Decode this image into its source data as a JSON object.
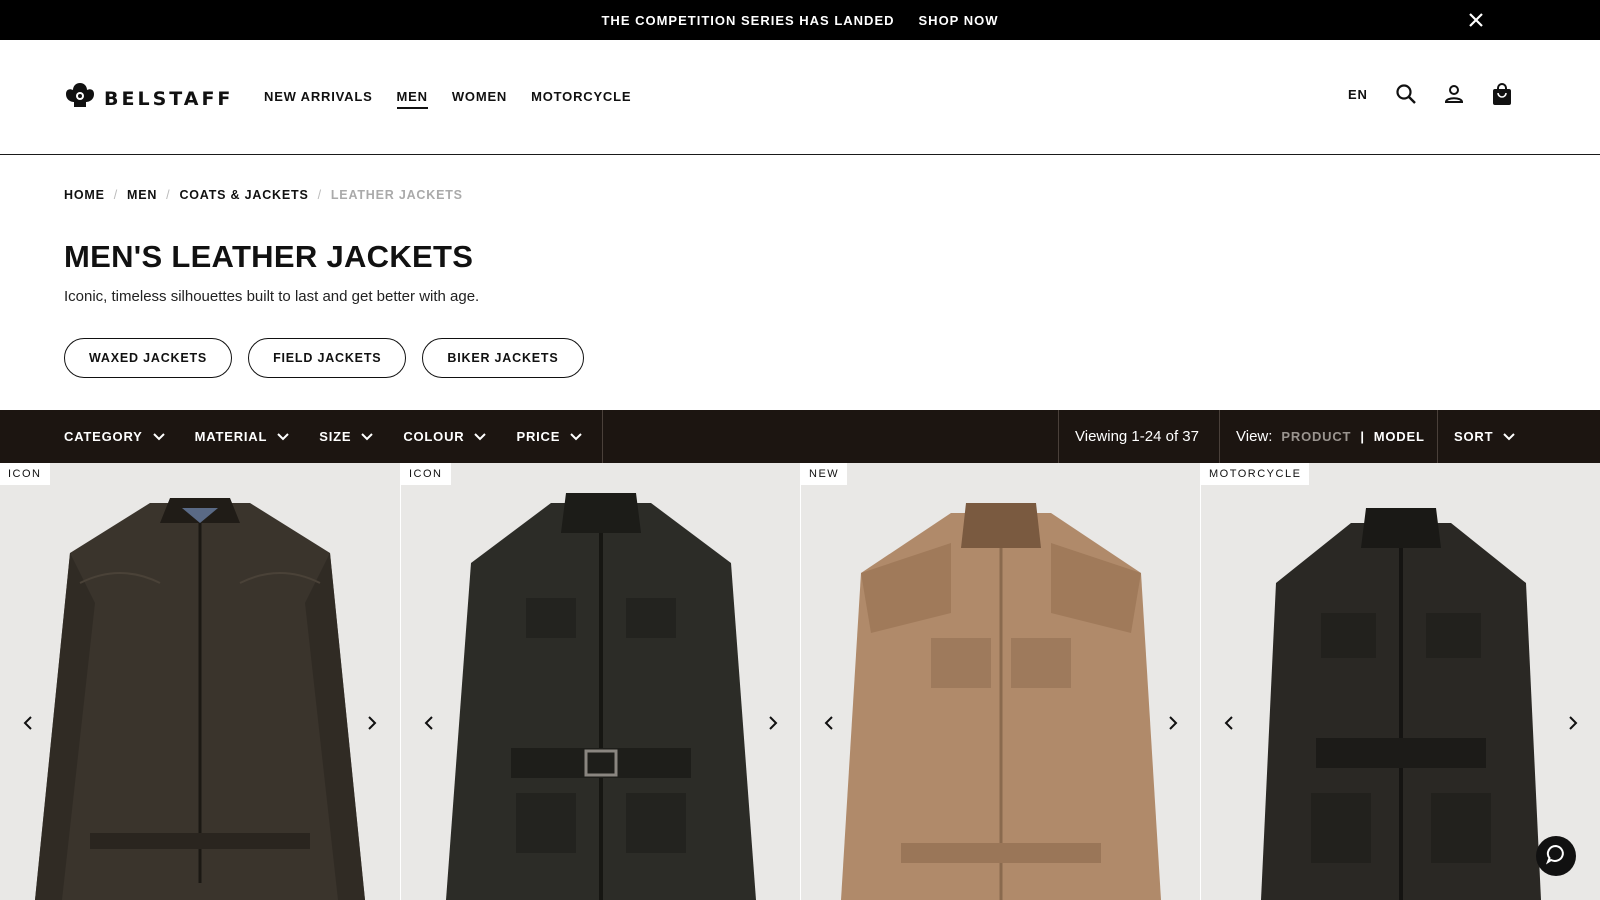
{
  "promo": {
    "text": "THE COMPETITION SERIES HAS LANDED",
    "link": "SHOP NOW"
  },
  "header": {
    "brand": "BELSTAFF",
    "nav": [
      "NEW ARRIVALS",
      "MEN",
      "WOMEN",
      "MOTORCYCLE"
    ],
    "active_nav": "MEN",
    "lang": "EN"
  },
  "breadcrumb": {
    "items": [
      "HOME",
      "MEN",
      "COATS & JACKETS"
    ],
    "current": "LEATHER JACKETS",
    "separator": "/"
  },
  "page": {
    "title": "MEN'S LEATHER JACKETS",
    "description": "Iconic, timeless silhouettes built to last and get better with age."
  },
  "chips": [
    "WAXED JACKETS",
    "FIELD JACKETS",
    "BIKER JACKETS"
  ],
  "filterbar": {
    "filters": [
      "CATEGORY",
      "MATERIAL",
      "SIZE",
      "COLOUR",
      "PRICE"
    ],
    "viewing": "Viewing 1-24 of 37",
    "view_label": "View:",
    "view_product": "PRODUCT",
    "view_sep": "|",
    "view_model": "MODEL",
    "sort": "SORT"
  },
  "products": [
    {
      "badge": "ICON",
      "color": "#3a342c",
      "image": "racer-style-leather-jacket"
    },
    {
      "badge": "ICON",
      "color": "#2c2c27",
      "image": "belted-four-pocket-leather-jacket"
    },
    {
      "badge": "NEW",
      "color": "#b08a6a",
      "image": "tan-quilted-shoulder-leather-jacket"
    },
    {
      "badge": "MOTORCYCLE",
      "color": "#2a2824",
      "image": "belted-motorcycle-leather-jacket"
    }
  ],
  "colors": {
    "filterbar_bg": "#1c1511",
    "promo_bg": "#000000",
    "card_bg": "#e9e8e6"
  }
}
